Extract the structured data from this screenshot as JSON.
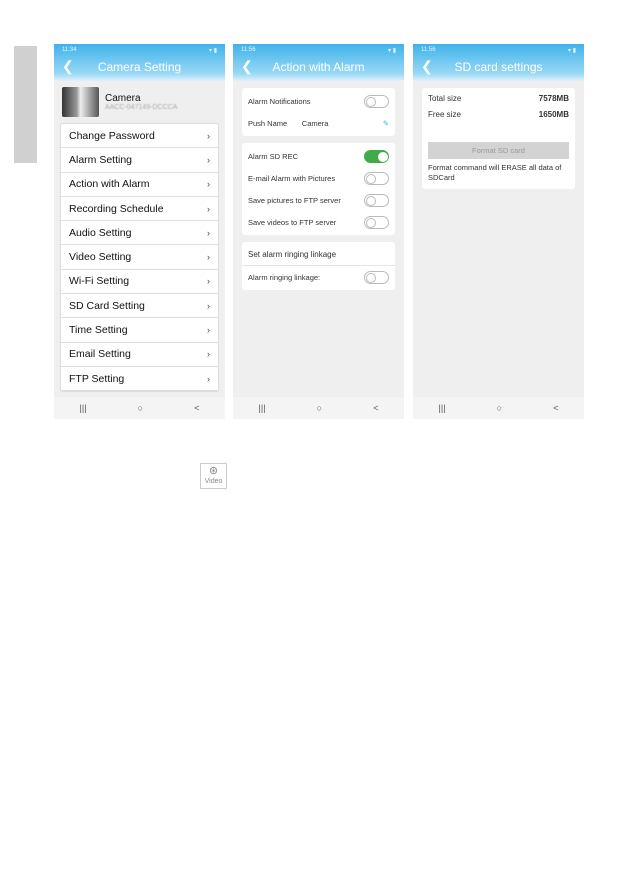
{
  "screen1": {
    "time": "11:34",
    "title": "Camera Setting",
    "camera_name": "Camera",
    "camera_id": "AACC-047149-DCCCA",
    "items": [
      "Change Password",
      "Alarm Setting",
      "Action with Alarm",
      "Recording Schedule",
      "Audio Setting",
      "Video Setting",
      "Wi-Fi Setting",
      "SD Card Setting",
      "Time Setting",
      "Email Setting",
      "FTP Setting"
    ]
  },
  "screen2": {
    "time": "11:56",
    "title": "Action with Alarm",
    "alarm_notifications": "Alarm Notifications",
    "push_name_label": "Push Name",
    "push_name_value": "Camera",
    "alarm_sd_rec": "Alarm SD REC",
    "email_alarm": "E-mail Alarm with Pictures",
    "save_pictures": "Save pictures to FTP server",
    "save_videos": "Save videos to FTP server",
    "ringing_header": "Set alarm ringing linkage",
    "ringing_label": "Alarm ringing linkage:",
    "toggles": {
      "alarm_notifications": false,
      "alarm_sd_rec": true,
      "email_alarm": false,
      "save_pictures": false,
      "save_videos": false,
      "ringing": false
    }
  },
  "screen3": {
    "time": "11:56",
    "title": "SD card settings",
    "total_label": "Total size",
    "total_value": "7578MB",
    "free_label": "Free size",
    "free_value": "1650MB",
    "format_button": "Format SD card",
    "warning": "Format command will ERASE all data of SDCard"
  },
  "nav": {
    "recent": "|||",
    "home": "○",
    "back": "<"
  },
  "video_icon_label": "Video",
  "colors": {
    "accent": "#3fb3ea",
    "toggle_on": "#3fab4a"
  }
}
